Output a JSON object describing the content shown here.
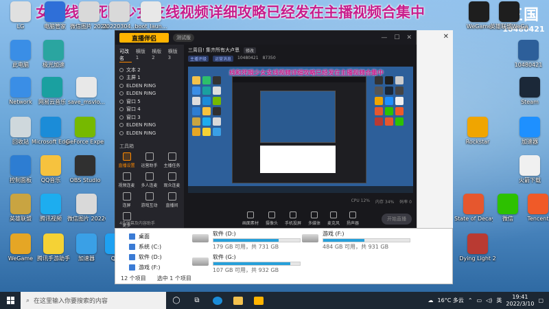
{
  "banner": "女支线和死眼少女支线视频详细攻略已经发在主播视频合集中",
  "corner_logo": {
    "big": "三国",
    "small": "10480421"
  },
  "desktop_icons": [
    {
      "label": "LG",
      "color": "#e0e0e0",
      "icon": "lg-icon"
    },
    {
      "label": "电脑管家",
      "color": "#2f6fd8",
      "icon": "pc-manager-icon"
    },
    {
      "label": "微信图片 2021122...",
      "color": "#d9d9d9",
      "icon": "image-icon"
    },
    {
      "label": "20220304...",
      "color": "#d9d9d9",
      "icon": "image-icon"
    },
    {
      "label": "boot_laun...",
      "color": "#e8e8e8",
      "icon": "file-icon"
    },
    {
      "label": "此电脑",
      "color": "#3a8ee6",
      "icon": "computer-icon"
    },
    {
      "label": "极光加速",
      "color": "#2aa5a0",
      "icon": "accelerator-icon"
    },
    {
      "label": "Network",
      "color": "#3a8ee6",
      "icon": "network-icon"
    },
    {
      "label": "网易云音乐",
      "color": "#1aa0a0",
      "icon": "music-icon"
    },
    {
      "label": "save_msvlo...",
      "color": "#e8e8e8",
      "icon": "file-icon"
    },
    {
      "label": "回收站",
      "color": "#cfd8dc",
      "icon": "recycle-bin-icon"
    },
    {
      "label": "Microsoft Edge",
      "color": "#1b8cd8",
      "icon": "edge-icon"
    },
    {
      "label": "GeForce Experience",
      "color": "#76b900",
      "icon": "geforce-icon"
    },
    {
      "label": "控制面板",
      "color": "#2d7dd2",
      "icon": "control-panel-icon"
    },
    {
      "label": "QQ音乐",
      "color": "#f6c23e",
      "icon": "qq-music-icon"
    },
    {
      "label": "OBS Studio",
      "color": "#303030",
      "icon": "obs-icon"
    },
    {
      "label": "英雄联盟",
      "color": "#c9a441",
      "icon": "lol-icon"
    },
    {
      "label": "腾讯视频",
      "color": "#1dadef",
      "icon": "tencent-video-icon"
    },
    {
      "label": "微信图片 20220305...",
      "color": "#d9d9d9",
      "icon": "image-icon"
    },
    {
      "label": "WeGame",
      "color": "#e5a625",
      "icon": "wegame-icon"
    },
    {
      "label": "腾讯手游助手",
      "color": "#f5d235",
      "icon": "mobile-game-icon"
    },
    {
      "label": "加速器",
      "color": "#3aa0e6",
      "icon": "speed-icon"
    },
    {
      "label": "QQ",
      "color": "#1ea1f2",
      "icon": "qq-icon"
    },
    {
      "label": "WeGame",
      "color": "#1e1e1e",
      "icon": "wegame-icon"
    },
    {
      "label": "英雄联盟WeGame",
      "color": "#1e1e1e",
      "icon": "lol-icon"
    },
    {
      "label": "10480421",
      "color": "#2d5f9a",
      "icon": "logo-icon"
    },
    {
      "label": "Steam",
      "color": "#1b2838",
      "icon": "steam-icon"
    },
    {
      "label": "Rockstar",
      "color": "#f0a500",
      "icon": "rockstar-icon"
    },
    {
      "label": "加速器",
      "color": "#1e90ff",
      "icon": "speed-icon"
    },
    {
      "label": "火箭下载",
      "color": "#f0f0f0",
      "icon": "file-icon"
    },
    {
      "label": "State of Decay 2",
      "color": "#e6572e",
      "icon": "game-icon"
    },
    {
      "label": "微信",
      "color": "#2dc100",
      "icon": "wechat-icon"
    },
    {
      "label": "Tencent",
      "color": "#f05a28",
      "icon": "game-icon"
    },
    {
      "label": "Dying Light 2",
      "color": "#b93a32",
      "icon": "game-icon"
    }
  ],
  "app": {
    "logo": "直播伴侣",
    "version": "测试版",
    "side_tabs": [
      "可改名",
      "横版 1",
      "横版 2",
      "横版 3"
    ],
    "scenes": [
      "文本 2",
      "主屏 1",
      "ELDEN RING",
      "ELDEN RING",
      "窗口 5",
      "窗口 4",
      "窗口 3",
      "ELDEN RING",
      "ELDEN RING"
    ],
    "tools_title": "工具箱",
    "tools": [
      {
        "label": "直播设置",
        "active": true
      },
      {
        "label": "运营助手",
        "active": false
      },
      {
        "label": "主播任务",
        "active": false
      },
      {
        "label": "视频连麦",
        "active": false
      },
      {
        "label": "多人连麦",
        "active": false
      },
      {
        "label": "观众连麦",
        "active": false
      },
      {
        "label": "连屏",
        "active": false
      },
      {
        "label": "游戏互动",
        "active": false
      },
      {
        "label": "直播间",
        "active": false
      },
      {
        "label": "更多",
        "active": false
      }
    ],
    "side_foot": "4条弹幕及内容助手",
    "room_title": "三周目! 集齐所有大卢恩",
    "room_chip": "修改",
    "stats": [
      "主播评级",
      "运营消息",
      "10480421",
      "87350"
    ],
    "preview_banner": "线和死眼少女支线视频详细攻略已经发在主播视频合集中",
    "status_items": [
      "CPU 12%",
      "内存 34%",
      "码率 0"
    ],
    "bottom_buttons": [
      "画面素材",
      "摄像头",
      "手机投屏",
      "多媒体",
      "麦克风",
      "扬声器"
    ],
    "start_label": "开始直播"
  },
  "explorer": {
    "nav": [
      {
        "label": "桌面"
      },
      {
        "label": "系统 (C:)"
      },
      {
        "label": "软件 (D:)"
      },
      {
        "label": "游戏 (F:)"
      }
    ],
    "drives": [
      {
        "name": "软件 (D:)",
        "size": "179 GB 可用，共 731 GB",
        "used_fraction": 0.755
      },
      {
        "name": "游戏 (F:)",
        "size": "484 GB 可用，共 931 GB",
        "used_fraction": 0.48
      },
      {
        "name": "软件 (G:)",
        "size": "107 GB 可用，共 932 GB",
        "used_fraction": 0.885
      }
    ],
    "status_items": "12 个项目",
    "status_selected": "选中 1 个项目"
  },
  "taskbar": {
    "search_placeholder": "在这里输入你要搜索的内容",
    "weather": "16°C 多云",
    "ime": "英",
    "time": "19:41",
    "date": "2022/3/10"
  }
}
